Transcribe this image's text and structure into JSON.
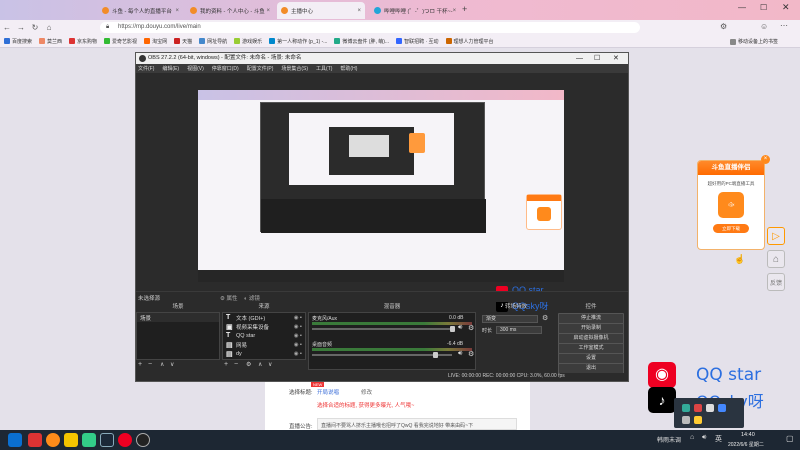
{
  "browser": {
    "tabs": [
      {
        "title": "斗鱼 - 每个人的直播平台",
        "color": "#f28c28"
      },
      {
        "title": "我的资料 - 个人中心 - 斗鱼",
        "color": "#f28c28"
      },
      {
        "title": "主播中心",
        "color": "#f28c28"
      },
      {
        "title": "哔哩哔哩 (゜-゜)つロ 干杯~-",
        "color": "#22a5d8"
      }
    ],
    "url": "https://mp.douyu.com/live/main",
    "bookmarks": [
      "百度搜索",
      "莫兰西",
      "京东购物",
      "爱奇艺影视",
      "淘宝网",
      "天猫",
      "网址导航",
      "游戏娱乐",
      "第一人称动作 (p_1) -...",
      "微博云盘件 (胖, 萌)...",
      "智联招聘 · 互动",
      "理想人力管理平台"
    ],
    "bookmark_right": "移动设备上的书签"
  },
  "obs": {
    "title": "OBS 27.2.2 (64-bit, windows) - 配置文件: 未命名 - 场景: 未命名",
    "menu": [
      "文件(F)",
      "编辑(E)",
      "视图(V)",
      "停靠窗口(D)",
      "配置文件(P)",
      "场景集合(S)",
      "工具(T)",
      "帮助(H)"
    ],
    "status_left": "未选择源",
    "status_props": "属性",
    "status_filters": "滤镜",
    "docks": {
      "scenes": "场景",
      "sources": "来源",
      "mixer": "混音器",
      "transitions": "转场特效",
      "controls": "控件"
    },
    "scene_item": "场景",
    "sources": [
      "文本 (GDI+)",
      "视频采集设备",
      "QQ star",
      "网易",
      "dy",
      "mpl"
    ],
    "mixer_tracks": [
      {
        "name": "麦克风/Aux",
        "db": "0.0 dB"
      },
      {
        "name": "桌面音频",
        "db": "-6.4 dB"
      }
    ],
    "transition": "渐变",
    "duration_label": "时长",
    "duration_value": "300 ms",
    "controls": [
      "停止推流",
      "开始录制",
      "启动虚拟摄像机",
      "工作室模式",
      "设置",
      "退出"
    ],
    "statusbar": "LIVE: 00:00:00   REC: 00:00:00   CPU: 3.0%, 60.00 fps",
    "overlay": {
      "netease": "QQ star",
      "tiktok": "QQsky呀"
    }
  },
  "page": {
    "label_title": "选择标题:",
    "label_new": "NEW",
    "title_value": "开局说唱",
    "edit": "修改",
    "tip": "选择合适的标题, 获得更多曝光, 人气哦~",
    "label_notice": "直播公告:",
    "notice_value": "直播间不要骂人挤乐主播哦也招呼了QwQ 看我完说地好 带来由码~下"
  },
  "overlay_main": {
    "netease": "QQ star",
    "tiktok": "QQsky呀"
  },
  "promo": {
    "title": "斗鱼直播伴侣",
    "subtitle": "超好用的PC端直播工具",
    "button": "立即下载"
  },
  "taskbar": {
    "tray_text": "韩雨未调",
    "time": "14:40",
    "date": "2022/6/6 星期二"
  }
}
